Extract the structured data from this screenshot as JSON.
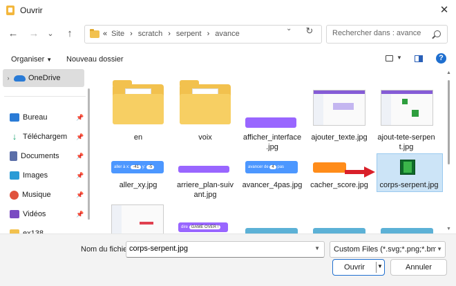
{
  "window": {
    "title": "Ouvrir",
    "close_glyph": "✕"
  },
  "nav": {
    "back": "←",
    "forward": "→",
    "down": "⌄",
    "up": "↑",
    "refresh": "↻"
  },
  "address": {
    "crumbs": [
      "«",
      "Site",
      "scratch",
      "serpent",
      "avance"
    ],
    "search_placeholder": "Rechercher dans : avance"
  },
  "toolbar": {
    "organize": "Organiser",
    "new_folder": "Nouveau dossier",
    "help": "?"
  },
  "sidebar": {
    "onedrive": "OneDrive",
    "items": [
      {
        "label": "Bureau",
        "icon": "desktop-icon",
        "color": "#2a7bd6"
      },
      {
        "label": "Téléchargem",
        "icon": "download-icon",
        "color": "#1aa36f"
      },
      {
        "label": "Documents",
        "icon": "documents-icon",
        "color": "#5b6ea8"
      },
      {
        "label": "Images",
        "icon": "images-icon",
        "color": "#2a9bd6"
      },
      {
        "label": "Musique",
        "icon": "music-icon",
        "color": "#e0533d"
      },
      {
        "label": "Vidéos",
        "icon": "videos-icon",
        "color": "#7a4bc2"
      },
      {
        "label": "ex138",
        "icon": "folder-icon",
        "color": "#f2c14e"
      }
    ]
  },
  "files": [
    {
      "label": "en",
      "kind": "folder"
    },
    {
      "label": "voix",
      "kind": "folder"
    },
    {
      "label": "afficher_interface\n.jpg",
      "kind": "image"
    },
    {
      "label": "ajouter_texte.jpg",
      "kind": "image"
    },
    {
      "label": "ajout-tete-serpen\nt.jpg",
      "kind": "image"
    },
    {
      "label": "aller_xy.jpg",
      "kind": "image"
    },
    {
      "label": "arriere_plan-suiv\nant.jpg",
      "kind": "image"
    },
    {
      "label": "avancer_4pas.jpg",
      "kind": "image"
    },
    {
      "label": "cacher_score.jpg",
      "kind": "image"
    },
    {
      "label": "corps-serpent.jpg",
      "kind": "image",
      "selected": true
    }
  ],
  "thumb_text": {
    "aller": "aller à x:",
    "x_val": "-41",
    "y_lbl": "y:",
    "y_val": "-5",
    "avancer": "avancer de",
    "avancer_val": "4",
    "avancer_unit": "pas",
    "dire": "dire",
    "game_over": "GAME OVER !"
  },
  "footer": {
    "filename_label": "Nom du fichier :",
    "filename_value": "corps-serpent.jpg",
    "filter": "Custom Files (*.svg;*.png;*.bmp;",
    "open": "Ouvrir",
    "cancel": "Annuler"
  },
  "colors": {
    "accent": "#1f6fcf",
    "selection": "#cce4f7",
    "folder": "#f2c14e",
    "arrow": "#d9202a"
  }
}
